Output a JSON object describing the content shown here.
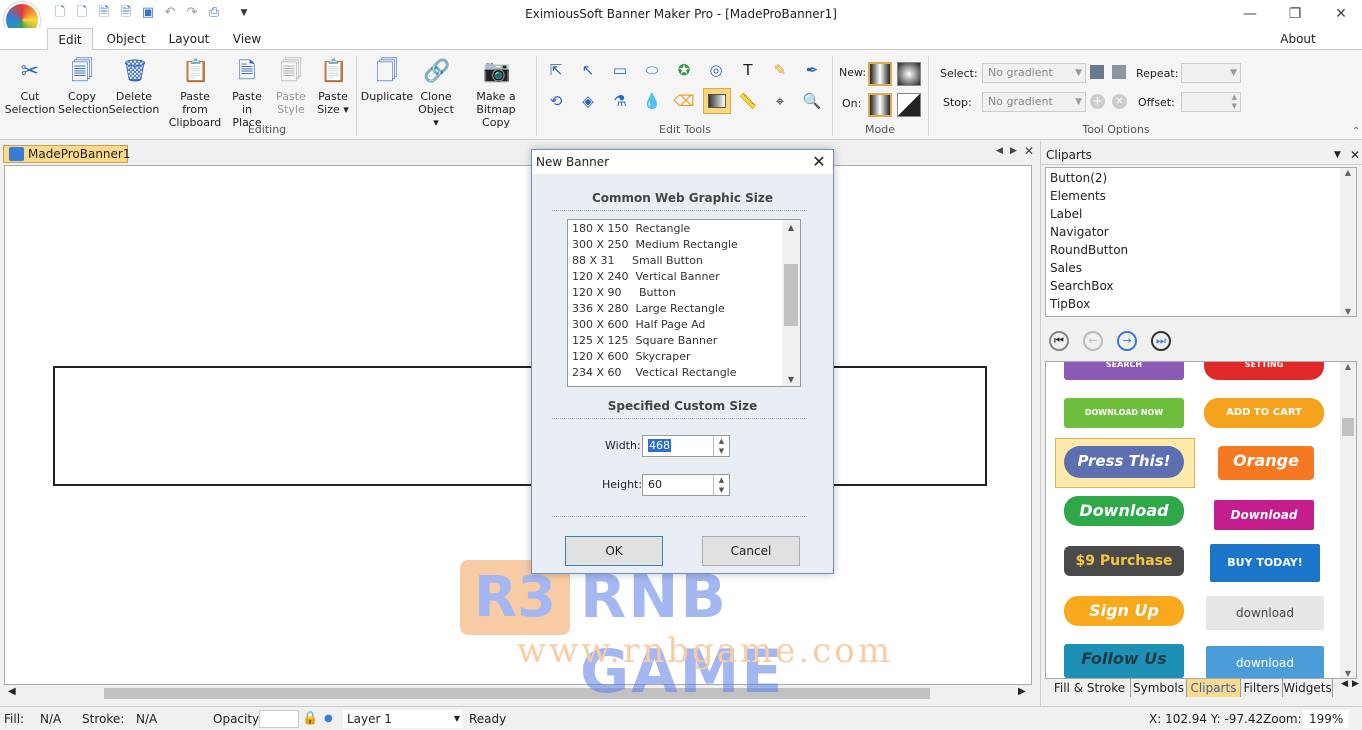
{
  "app": {
    "title": "EximiousSoft Banner Maker Pro - [MadeProBanner1]",
    "about": "About"
  },
  "tabs": [
    "Edit",
    "Object",
    "Layout",
    "View"
  ],
  "ribbon": {
    "editing": {
      "label": "Editing",
      "cut": "Cut Selection",
      "copy": "Copy Selection",
      "delete": "Delete Selection",
      "paste_clip": "Paste from Clipboard",
      "paste_place": "Paste in Place",
      "paste_style": "Paste Style",
      "paste_size": "Paste Size ▾"
    },
    "object": {
      "duplicate": "Duplicate",
      "clone": "Clone Object ▾",
      "make_bitmap": "Make a Bitmap Copy"
    },
    "edit_tools": {
      "label": "Edit Tools"
    },
    "mode": {
      "label": "Mode",
      "new": "New:",
      "on": "On:"
    },
    "tool_options": {
      "label": "Tool Options",
      "select": "Select:",
      "stop": "Stop:",
      "select_value": "No gradient",
      "stop_value": "No gradient",
      "repeat": "Repeat:",
      "offset": "Offset:"
    }
  },
  "document": {
    "tab": "MadeProBanner1"
  },
  "panel": {
    "title": "Cliparts",
    "items": [
      "Button(2)",
      "Elements",
      "Label",
      "Navigator",
      "RoundButton",
      "Sales",
      "SearchBox",
      "TipBox"
    ],
    "gallery": [
      "SEARCH",
      "SETTING",
      "DOWNLOAD NOW",
      "ADD TO CART",
      "Press This!",
      "Orange",
      "Download",
      "Download",
      "$9 Purchase",
      "BUY TODAY!",
      "Sign Up",
      "download",
      "Follow Us",
      "download"
    ],
    "tabs": [
      "Fill & Stroke",
      "Symbols",
      "Cliparts",
      "Filters",
      "Widgets"
    ]
  },
  "status": {
    "fill_label": "Fill:",
    "fill": "N/A",
    "stroke_label": "Stroke:",
    "stroke": "N/A",
    "opacity_label": "Opacity:",
    "layer": "Layer 1",
    "state": "Ready",
    "coords": "X: 102.94 Y: -97.42",
    "zoom_label": "Zoom:",
    "zoom": "199%"
  },
  "dialog": {
    "title": "New Banner",
    "common_header": "Common Web Graphic  Size",
    "sizes": [
      "180 X 150  Rectangle",
      "300 X 250  Medium Rectangle",
      "88 X 31     Small Button",
      "120 X 240  Vertical Banner",
      "120 X 90     Button",
      "336 X 280  Large Rectangle",
      "300 X 600  Half Page Ad",
      "125 X 125  Square Banner",
      "120 X 600  Skycraper",
      "234 X 60    Vectical Rectangle"
    ],
    "custom_header": "Specified Custom Size",
    "width_label": "Width:",
    "width": "468",
    "height_label": "Height:",
    "height": "60",
    "ok": "OK",
    "cancel": "Cancel"
  },
  "watermark": {
    "brand": "RNB GAME",
    "url": "www.rnbgame.com"
  }
}
